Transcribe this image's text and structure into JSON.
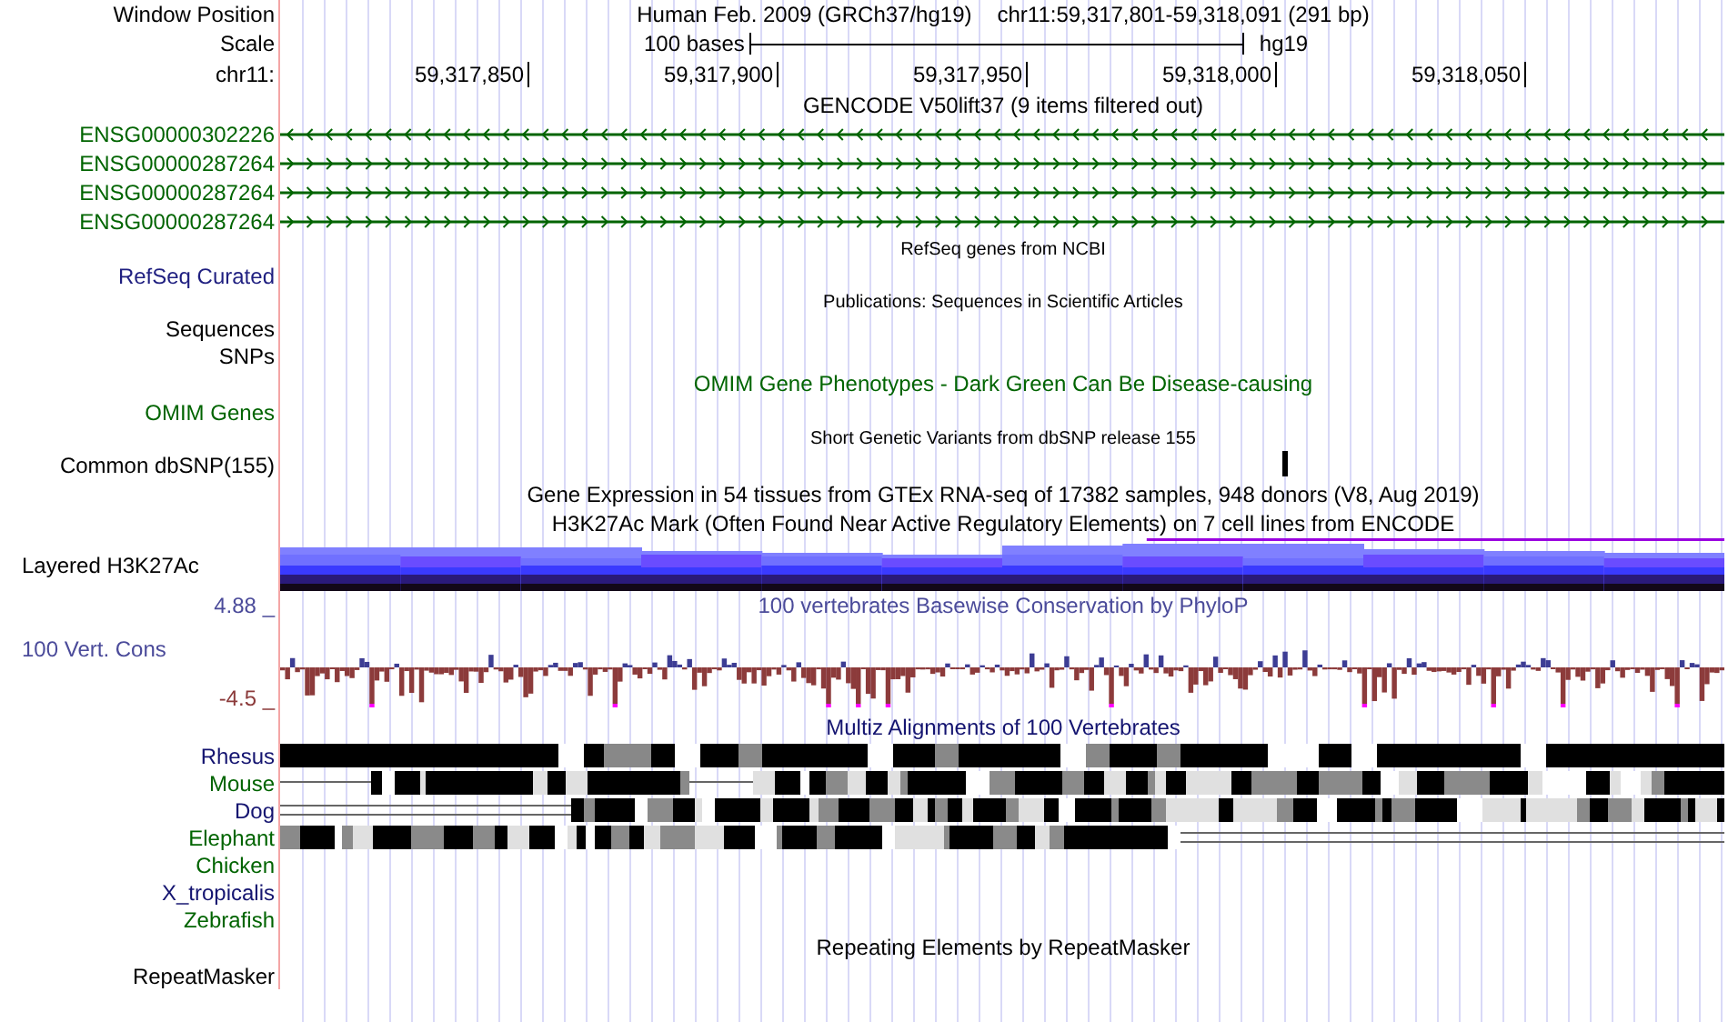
{
  "rows": [
    {
      "kind": "position",
      "label": "Window Position",
      "assembly": "Human Feb. 2009 (GRCh37/hg19)",
      "range": "chr11:59,317,801-59,318,091 (291 bp)"
    },
    {
      "kind": "scale",
      "label": "Scale",
      "length": "100 bases",
      "db": "hg19"
    },
    {
      "kind": "ruler",
      "label": "chr11:",
      "ticks": [
        "59,317,850",
        "59,317,900",
        "59,317,950",
        "59,318,000",
        "59,318,050"
      ]
    },
    {
      "kind": "title",
      "text": "GENCODE V50lift37 (9 items filtered out)"
    },
    {
      "kind": "gene",
      "label": "ENSG00000302226",
      "reverse_strand": true,
      "color": "#006400"
    },
    {
      "kind": "gene",
      "label": "ENSG00000287264",
      "reverse_strand": false,
      "color": "#006400"
    },
    {
      "kind": "gene",
      "label": "ENSG00000287264",
      "reverse_strand": false,
      "color": "#006400"
    },
    {
      "kind": "gene",
      "label": "ENSG00000287264",
      "reverse_strand": false,
      "color": "#006400"
    },
    {
      "kind": "note",
      "text": "RefSeq genes from NCBI"
    },
    {
      "kind": "label",
      "label": "RefSeq Curated",
      "color": "#1f1f80"
    },
    {
      "kind": "note",
      "text": "Publications: Sequences in Scientific Articles"
    },
    {
      "kind": "label",
      "label": "Sequences"
    },
    {
      "kind": "label",
      "label": "SNPs"
    },
    {
      "kind": "title",
      "text": "OMIM Gene Phenotypes - Dark Green Can Be Disease-causing",
      "color": "#006400"
    },
    {
      "kind": "label",
      "label": "OMIM Genes",
      "color": "#006400"
    },
    {
      "kind": "note",
      "text": "Short Genetic Variants from dbSNP release 155"
    },
    {
      "kind": "snp",
      "label": "Common dbSNP(155)"
    },
    {
      "kind": "title",
      "text": "Gene Expression in 54 tissues from GTEx RNA-seq of 17382 samples, 948 donors (V8, Aug 2019)"
    },
    {
      "kind": "title",
      "text": "H3K27Ac Mark (Often Found Near Active Regulatory Elements) on 7 cell lines from ENCODE"
    },
    {
      "kind": "layered",
      "label": "Layered H3K27Ac"
    },
    {
      "kind": "axis",
      "label": "4.88 _",
      "text": "100 vertebrates Basewise Conservation by PhyloP",
      "color": "#4b4b9a"
    },
    {
      "kind": "conservation",
      "label": "100 Vert. Cons",
      "min": "-4.5 _",
      "color": "#4b4b9a"
    },
    {
      "kind": "title",
      "text": "Multiz Alignments of 100 Vertebrates",
      "color": "#141470"
    },
    {
      "kind": "species",
      "label": "Rhesus",
      "color": "#141470"
    },
    {
      "kind": "species",
      "label": "Mouse",
      "color": "#006400"
    },
    {
      "kind": "species",
      "label": "Dog",
      "color": "#141470"
    },
    {
      "kind": "species",
      "label": "Elephant",
      "color": "#006400"
    },
    {
      "kind": "species",
      "label": "Chicken",
      "color": "#006400"
    },
    {
      "kind": "species",
      "label": "X_tropicalis",
      "color": "#141470"
    },
    {
      "kind": "species",
      "label": "Zebrafish",
      "color": "#006400"
    },
    {
      "kind": "title",
      "text": "Repeating Elements by RepeatMasker"
    },
    {
      "kind": "label",
      "label": "RepeatMasker"
    }
  ]
}
